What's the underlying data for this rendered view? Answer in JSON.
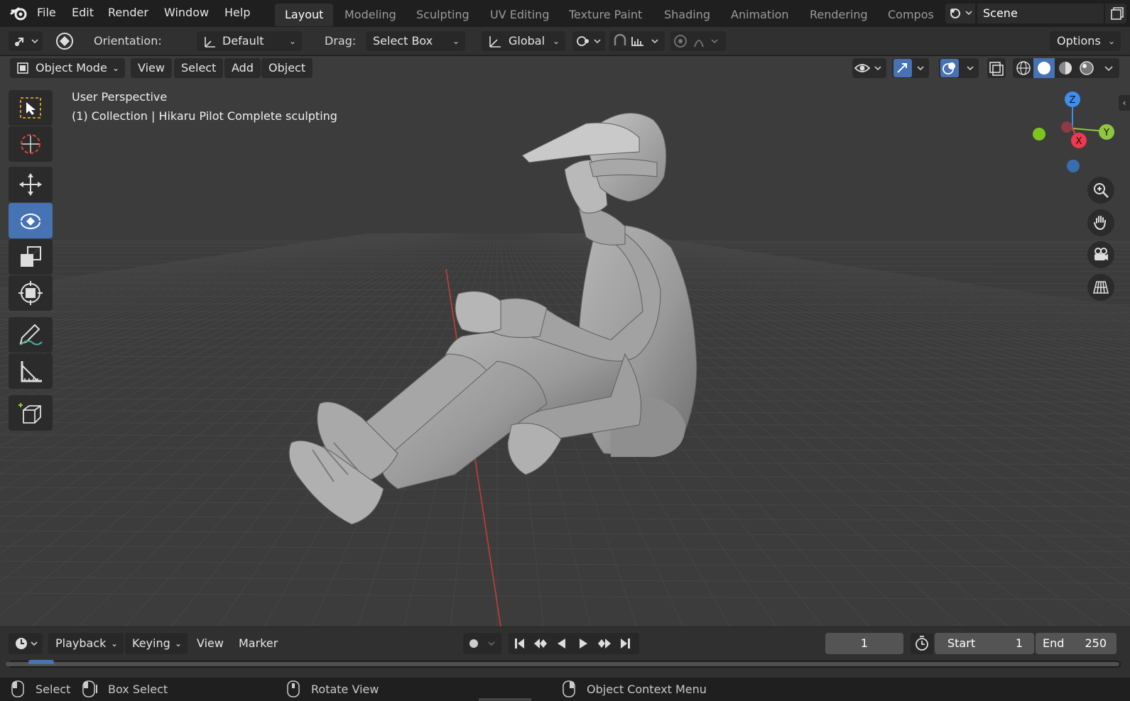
{
  "menubar": {
    "items": [
      "File",
      "Edit",
      "Render",
      "Window",
      "Help"
    ],
    "workspaces": [
      "Layout",
      "Modeling",
      "Sculpting",
      "UV Editing",
      "Texture Paint",
      "Shading",
      "Animation",
      "Rendering",
      "Compos"
    ],
    "active_workspace": "Layout",
    "scene_name": "Scene"
  },
  "tool_settings": {
    "orientation_label": "Orientation:",
    "orientation_value": "Default",
    "drag_label": "Drag:",
    "drag_value": "Select Box",
    "transform_orientation": "Global",
    "options_label": "Options"
  },
  "viewport_header": {
    "mode": "Object Mode",
    "menus": [
      "View",
      "Select",
      "Add",
      "Object"
    ]
  },
  "viewport": {
    "view_name": "User Perspective",
    "collection_info": "(1) Collection | Hikaru Pilot Complete sculpting",
    "background_color": "#3c3c3c",
    "grid_color": "#464646",
    "x_axis_color": "#c43c3c"
  },
  "gizmo": {
    "x_label": "X",
    "y_label": "Y",
    "z_label": "Z",
    "x_color": "#f0384e",
    "y_color": "#8ec63f",
    "z_color": "#3e8ef0"
  },
  "toolbar": {
    "tools": [
      "select-box",
      "cursor",
      "move",
      "rotate",
      "scale",
      "transform",
      "annotate",
      "measure",
      "add-cube"
    ],
    "active_tool": "rotate",
    "active_color": "#4772b3"
  },
  "timeline": {
    "menus": [
      "Playback",
      "Keying",
      "View",
      "Marker"
    ],
    "current_frame": "1",
    "start_label": "Start",
    "start_value": "1",
    "end_label": "End",
    "end_value": "250"
  },
  "statusbar": {
    "select": "Select",
    "box_select": "Box Select",
    "rotate_view": "Rotate View",
    "context_menu": "Object Context Menu"
  }
}
